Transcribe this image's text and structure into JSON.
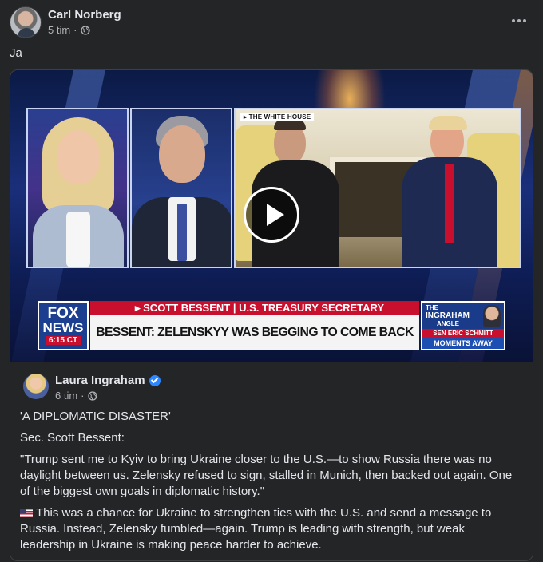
{
  "post": {
    "author": "Carl Norberg",
    "time": "5 tim",
    "text": "Ja"
  },
  "video": {
    "location_label": "▸ THE WHITE HOUSE",
    "network_logo": {
      "line1": "FOX",
      "line2": "NEWS",
      "time": "6:15 CT"
    },
    "chyron_top": "▸ SCOTT BESSENT | U.S. TREASURY SECRETARY",
    "chyron_main": "BESSENT: ZELENSKYY WAS BEGGING TO COME BACK",
    "promo": {
      "title_line1": "THE",
      "title_line2": "INGRAHAM",
      "title_line3": "ANGLE",
      "guest": "SEN ERIC SCHMITT",
      "status": "MOMENTS AWAY"
    }
  },
  "shared_post": {
    "author": "Laura Ingraham",
    "time": "6 tim",
    "paragraphs": [
      "'A DIPLOMATIC DISASTER'",
      "Sec. Scott Bessent:",
      "\"Trump sent me to Kyiv to bring Ukraine closer to the U.S.—to show Russia there was no daylight between us. Zelensky refused to sign, stalled in Munich, then backed out again. One of the biggest own goals in diplomatic history.\"",
      "This was a chance for Ukraine to strengthen ties with the U.S. and send a message to Russia. Instead, Zelensky fumbled—again. Trump is leading with strength, but weak leadership in Ukraine is making peace harder to achieve."
    ]
  },
  "colors": {
    "background": "#242526",
    "text_primary": "#e4e6eb",
    "text_secondary": "#b0b3b8",
    "verified": "#2d88ff",
    "fox_red": "#c8102e",
    "fox_blue": "#1c3f8f"
  },
  "icons": [
    "globe-icon",
    "more-options-icon",
    "play-icon",
    "verified-badge-icon",
    "us-flag-icon"
  ]
}
